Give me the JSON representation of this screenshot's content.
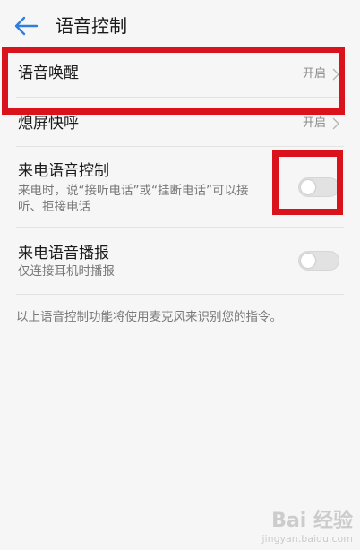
{
  "header": {
    "title": "语音控制",
    "back_icon": "arrow-left-icon",
    "accent": "#2f7fe0"
  },
  "rows": {
    "wake": {
      "title": "语音唤醒",
      "value": "开启"
    },
    "screen_off": {
      "title": "熄屏快呼",
      "value": "开启"
    },
    "call_control": {
      "title": "来电语音控制",
      "desc_line1": "来电时，说“接听电话”或“挂断电话”可以接",
      "desc_line2": "听、拒接电话",
      "enabled": false
    },
    "call_broadcast": {
      "title": "来电语音播报",
      "desc": "仅连接耳机时播报",
      "enabled": false
    }
  },
  "footer_note": "以上语音控制功能将使用麦克风来识别您的指令。",
  "highlight_color": "#d9121c",
  "watermark": {
    "logo": "Bai 经验",
    "url": "jingyan.baidu.com"
  }
}
